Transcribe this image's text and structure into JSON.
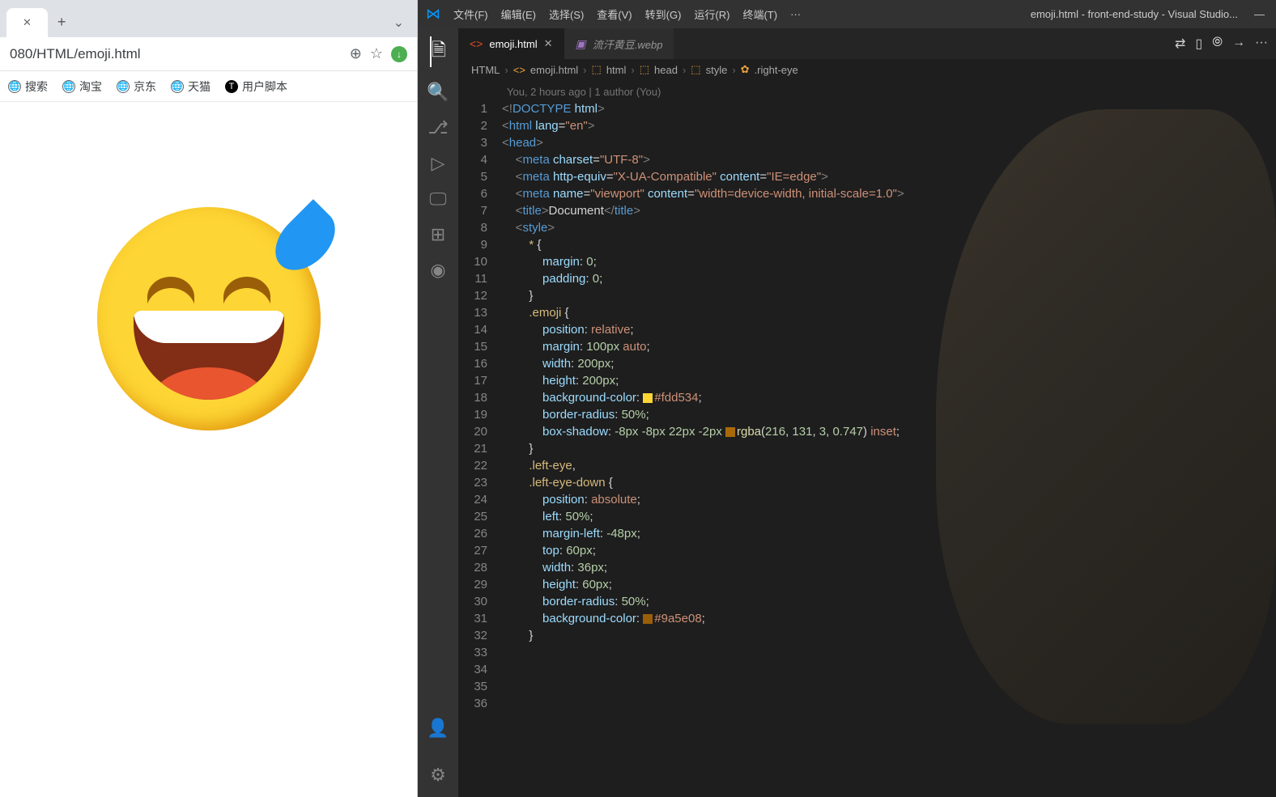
{
  "browser": {
    "url": "080/HTML/emoji.html",
    "bookmarks": [
      "搜索",
      "淘宝",
      "京东",
      "天猫",
      "用户脚本"
    ]
  },
  "vscode": {
    "menus": [
      "文件(F)",
      "编辑(E)",
      "选择(S)",
      "查看(V)",
      "转到(G)",
      "运行(R)",
      "终端(T)"
    ],
    "title": "emoji.html - front-end-study - Visual Studio...",
    "tabs": [
      {
        "name": "emoji.html",
        "active": true
      },
      {
        "name": "流汗黄豆.webp",
        "active": false
      }
    ],
    "breadcrumbs": [
      "HTML",
      "emoji.html",
      "html",
      "head",
      "style",
      ".right-eye"
    ],
    "codelens": "You, 2 hours ago | 1 author (You)",
    "lines": [
      1,
      2,
      3,
      4,
      5,
      6,
      7,
      8,
      9,
      10,
      11,
      12,
      13,
      14,
      15,
      16,
      17,
      18,
      19,
      20,
      21,
      22,
      23,
      24,
      25,
      26,
      27,
      28,
      29,
      30,
      31,
      32,
      33,
      34,
      35,
      36
    ]
  },
  "chart_data": {
    "type": "code",
    "file": "emoji.html",
    "content": "<!DOCTYPE html>\n<html lang=\"en\">\n\n<head>\n    <meta charset=\"UTF-8\">\n    <meta http-equiv=\"X-UA-Compatible\" content=\"IE=edge\">\n    <meta name=\"viewport\" content=\"width=device-width, initial-scale=1.0\">\n    <title>Document</title>\n    <style>\n        * {\n            margin: 0;\n            padding: 0;\n        }\n\n        .emoji {\n            position: relative;\n            margin: 100px auto;\n            width: 200px;\n            height: 200px;\n            background-color: #fdd534;\n            border-radius: 50%;\n            box-shadow: -8px -8px 22px -2px rgba(216, 131, 3, 0.747) inset;\n        }\n\n        .left-eye,\n        .left-eye-down {\n            position: absolute;\n            left: 50%;\n            margin-left: -48px;\n            top: 60px;\n            width: 36px;\n            height: 60px;\n            border-radius: 50%;\n            background-color: #9a5e08;\n        }\n"
  }
}
